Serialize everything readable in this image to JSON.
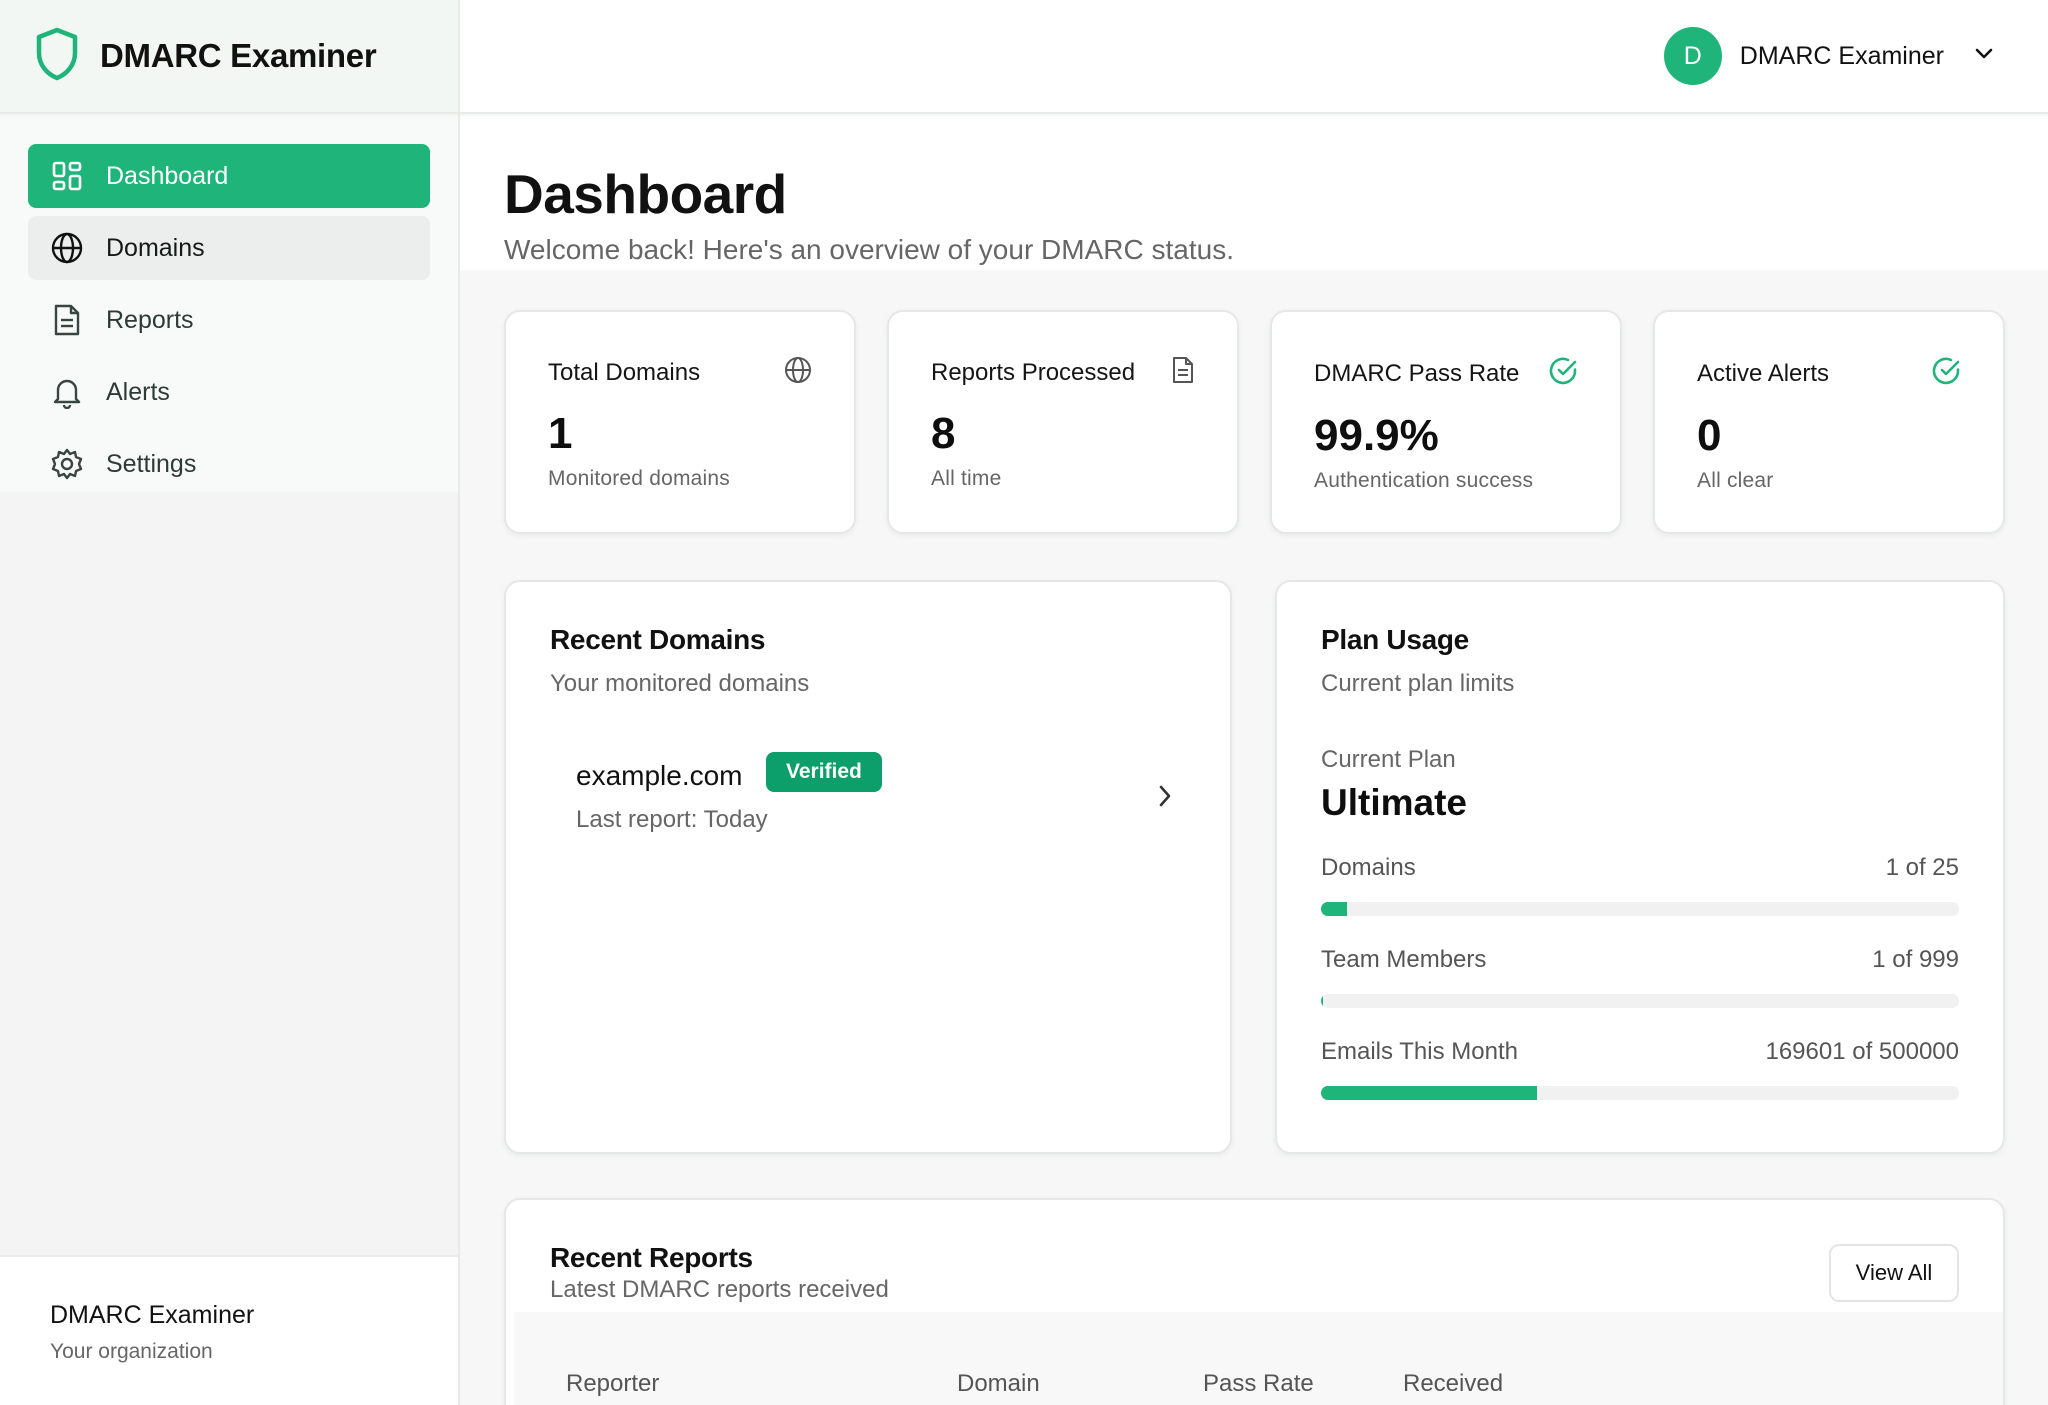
{
  "brand": {
    "name": "DMARC Examiner"
  },
  "sidebar": {
    "items": [
      {
        "label": "Dashboard",
        "icon": "dashboard-grid-icon"
      },
      {
        "label": "Domains",
        "icon": "globe-icon"
      },
      {
        "label": "Reports",
        "icon": "document-icon"
      },
      {
        "label": "Alerts",
        "icon": "bell-icon"
      },
      {
        "label": "Settings",
        "icon": "gear-icon"
      }
    ],
    "footer": {
      "org_name": "DMARC Examiner",
      "org_sub": "Your organization"
    }
  },
  "header": {
    "avatar_initial": "D",
    "user_name": "DMARC Examiner"
  },
  "page": {
    "title": "Dashboard",
    "subtitle": "Welcome back! Here's an overview of your DMARC status."
  },
  "stats": [
    {
      "label": "Total Domains",
      "value": "1",
      "sub": "Monitored domains",
      "icon": "globe-icon"
    },
    {
      "label": "Reports Processed",
      "value": "8",
      "sub": "All time",
      "icon": "document-icon"
    },
    {
      "label": "DMARC Pass Rate",
      "value": "99.9%",
      "sub": "Authentication success",
      "icon": "check-circle-icon"
    },
    {
      "label": "Active Alerts",
      "value": "0",
      "sub": "All clear",
      "icon": "check-circle-icon"
    }
  ],
  "recent_domains": {
    "title": "Recent Domains",
    "subtitle": "Your monitored domains",
    "items": [
      {
        "domain": "example.com",
        "badge": "Verified",
        "meta": "Last report: Today"
      }
    ]
  },
  "plan_usage": {
    "title": "Plan Usage",
    "subtitle": "Current plan limits",
    "current_plan_label": "Current Plan",
    "current_plan": "Ultimate",
    "rows": [
      {
        "label": "Domains",
        "value": "1 of 25",
        "fraction": 0.04
      },
      {
        "label": "Team Members",
        "value": "1 of 999",
        "fraction": 0.001
      },
      {
        "label": "Emails This Month",
        "value": "169601 of 500000",
        "fraction": 0.339
      }
    ]
  },
  "recent_reports": {
    "title": "Recent Reports",
    "subtitle": "Latest DMARC reports received",
    "view_all": "View All",
    "columns": [
      "Reporter",
      "Domain",
      "Pass Rate",
      "Received"
    ]
  },
  "colors": {
    "accent": "#1fb57a",
    "badge": "#0c9f6b"
  }
}
